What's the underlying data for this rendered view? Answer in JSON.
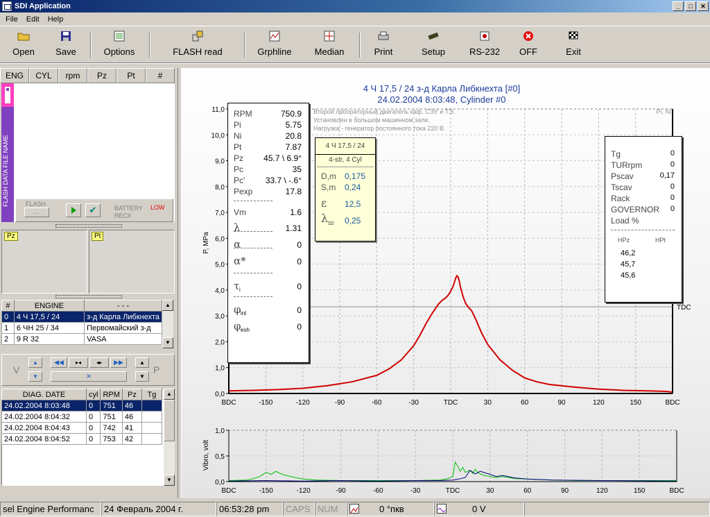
{
  "window": {
    "title": "SDI Application"
  },
  "menu": [
    "File",
    "Edit",
    "Help"
  ],
  "toolbar": [
    {
      "name": "open",
      "label": "Open",
      "icon": "folder-icon"
    },
    {
      "name": "save",
      "label": "Save",
      "icon": "floppy-icon"
    },
    {
      "name": "options",
      "label": "Options",
      "icon": "options-icon"
    },
    {
      "name": "flash-read",
      "label": "FLASH read",
      "icon": "flash-icon"
    },
    {
      "name": "grphline",
      "label": "Grphline",
      "icon": "graph-icon"
    },
    {
      "name": "median",
      "label": "Median",
      "icon": "median-icon"
    },
    {
      "name": "print",
      "label": "Print",
      "icon": "printer-icon"
    },
    {
      "name": "setup",
      "label": "Setup",
      "icon": "setup-icon"
    },
    {
      "name": "rs232",
      "label": "RS-232",
      "icon": "serial-icon"
    },
    {
      "name": "off",
      "label": "OFF",
      "icon": "stop-icon"
    },
    {
      "name": "exit",
      "label": "Exit",
      "icon": "flag-icon"
    }
  ],
  "top_table": {
    "headers": [
      "ENG",
      "CYL",
      "rpm",
      "Pz",
      "Pt",
      "#"
    ]
  },
  "flash": {
    "vertical_label": "FLASH DATA FILE NAME",
    "flash_label": "FLASH",
    "flash_btn": "...",
    "battery_label": "BATTERY",
    "battery_value": "LOW",
    "rec_label": "REC#"
  },
  "mini_panels": {
    "pz": "Pz",
    "pt": "Pt"
  },
  "engines": {
    "headers": [
      "#",
      "ENGINE",
      "- - -"
    ],
    "rows": [
      [
        "0",
        "4 Ч 17,5 / 24",
        "з-д Карла Либкнехта"
      ],
      [
        "1",
        "6 ЧН 25 / 34",
        "Первомайский з-д"
      ],
      [
        "2",
        "9 R 32",
        "VASA"
      ]
    ]
  },
  "nav": {
    "left": "V",
    "right": "P",
    "close": "×"
  },
  "diag": {
    "headers": [
      "DIAG. DATE",
      "cyl",
      "RPM",
      "Pz",
      "Tg"
    ],
    "rows": [
      [
        "24.02.2004 8:03:48",
        "0",
        "751",
        "46",
        ""
      ],
      [
        "24.02.2004 8:04:32",
        "0",
        "751",
        "46",
        ""
      ],
      [
        "24.02.2004 8:04:43",
        "0",
        "742",
        "41",
        ""
      ],
      [
        "24.02.2004 8:04:52",
        "0",
        "753",
        "42",
        ""
      ]
    ]
  },
  "chart_header": {
    "line1": "4 Ч 17,5 / 24 з-д Карла Либкнехта [#0]",
    "line2": "24.02.2004 8:03:48, Cylinder #0"
  },
  "notes": [
    "Второй лабораторный двигатель каф. СЭУ и ТЭ.",
    "Установлен в большом машинном зале.",
    "Нагрузка - генератор постоянного тока 220 В."
  ],
  "corner_label": "Pi, Ni",
  "params_left": [
    {
      "k": "RPM",
      "v": "750.9"
    },
    {
      "k": "Pi",
      "v": "5.75"
    },
    {
      "k": "Ni",
      "v": "20.8"
    },
    {
      "k": "Pt",
      "v": "7.87"
    },
    {
      "k": "Pz",
      "v": "45.7 \\ 6.9°"
    },
    {
      "k": "Pc",
      "v": "35"
    },
    {
      "k": "Pc'",
      "v": "33.7 \\ -.6°"
    },
    {
      "k": "Pexp",
      "v": "17.8"
    },
    {
      "k": "Vm",
      "v": "1.6"
    },
    {
      "k": "λ",
      "v": "1.31"
    },
    {
      "k": "α",
      "v": "0"
    },
    {
      "k": "α*",
      "v": "0"
    },
    {
      "k": "τ",
      "sub": "i",
      "v": "0"
    },
    {
      "k": "φ",
      "sub": "inl",
      "v": "0"
    },
    {
      "k": "φ",
      "sub": "exh",
      "v": "0"
    }
  ],
  "engine_card": {
    "title": "4 Ч 17,5 / 24",
    "subtitle": "4-str, 4 Cyl",
    "rows": [
      {
        "k": "D,m",
        "v": "0,175"
      },
      {
        "k": "S,m",
        "v": "0,24"
      },
      {
        "k": "ε",
        "v": "12,5"
      },
      {
        "k": "λ",
        "sub": "ш",
        "v": "0,25"
      }
    ]
  },
  "params_right": {
    "rows": [
      {
        "k": "Tg",
        "v": "0"
      },
      {
        "k": "TURrpm",
        "v": "0"
      },
      {
        "k": "Pscav",
        "v": "0,17"
      },
      {
        "k": "Tscav",
        "v": "0"
      },
      {
        "k": "Rack",
        "v": "0"
      },
      {
        "k": "GOVERNOR",
        "v": "0"
      },
      {
        "k": "Load %",
        "v": ""
      }
    ],
    "hpz_label": "HPz",
    "hpt_label": "HPt",
    "hpz_values": [
      "46,2",
      "45,7",
      "45,6"
    ]
  },
  "chart_data": [
    {
      "type": "line",
      "ylabel": "P, MPa",
      "ylim": [
        0,
        11
      ],
      "yticks": [
        "0,0",
        "1,0",
        "2,0",
        "3,0",
        "4,0",
        "5,0",
        "6,0",
        "7,0",
        "8,0",
        "9,0",
        "10,0",
        "11,0"
      ],
      "xticks": [
        "BDC",
        "-150",
        "-120",
        "-90",
        "-60",
        "-30",
        "TDC",
        "30",
        "60",
        "90",
        "120",
        "150",
        "BDC"
      ],
      "xlim": [
        -180,
        180
      ],
      "ref_line": {
        "y": 3.35,
        "label": "TDC"
      },
      "series": [
        {
          "color": "#d00000",
          "x": [
            -180,
            -160,
            -140,
            -120,
            -100,
            -80,
            -60,
            -50,
            -40,
            -30,
            -25,
            -20,
            -15,
            -10,
            -7,
            -4,
            -2,
            0,
            2,
            4,
            5,
            6,
            7,
            8,
            10,
            12,
            14,
            17,
            20,
            25,
            30,
            40,
            50,
            60,
            70,
            80,
            100,
            120,
            140,
            160,
            175,
            180
          ],
          "y": [
            0.1,
            0.12,
            0.15,
            0.2,
            0.3,
            0.45,
            0.7,
            0.95,
            1.3,
            1.85,
            2.25,
            2.7,
            3.1,
            3.45,
            3.6,
            3.7,
            3.8,
            3.95,
            4.15,
            4.45,
            4.55,
            4.5,
            4.35,
            4.1,
            3.75,
            3.5,
            3.35,
            3.2,
            2.9,
            2.35,
            1.9,
            1.3,
            0.9,
            0.6,
            0.45,
            0.35,
            0.25,
            0.17,
            0.12,
            0.1,
            0.08,
            0.05
          ]
        }
      ]
    },
    {
      "type": "line",
      "ylabel": "Vibro, volt",
      "ylim": [
        0,
        1
      ],
      "yticks": [
        "0,0",
        "0,5",
        "1,0"
      ],
      "xticks": [
        "BDC",
        "-150",
        "-120",
        "-90",
        "-60",
        "-30",
        "TDC",
        "30",
        "60",
        "90",
        "120",
        "150",
        "BDC"
      ],
      "xlim": [
        -180,
        180
      ],
      "series": [
        {
          "color": "#00c000",
          "x": [
            -180,
            -165,
            -160,
            -155,
            -150,
            -146,
            -142,
            -138,
            -134,
            -130,
            -125,
            -120,
            -110,
            -90,
            -60,
            -30,
            -10,
            -5,
            0,
            2,
            4,
            6,
            8,
            10,
            12,
            14,
            16,
            18,
            20,
            22,
            25,
            30,
            35,
            40,
            50,
            60,
            80,
            100,
            140,
            180
          ],
          "y": [
            0.02,
            0.03,
            0.06,
            0.1,
            0.18,
            0.14,
            0.2,
            0.15,
            0.12,
            0.1,
            0.07,
            0.05,
            0.03,
            0.02,
            0.02,
            0.02,
            0.03,
            0.05,
            0.1,
            0.38,
            0.3,
            0.2,
            0.28,
            0.18,
            0.2,
            0.22,
            0.16,
            0.24,
            0.18,
            0.15,
            0.12,
            0.1,
            0.08,
            0.1,
            0.06,
            0.05,
            0.03,
            0.02,
            0.02,
            0.02
          ]
        },
        {
          "color": "#000080",
          "x": [
            -180,
            -150,
            -120,
            -90,
            -60,
            -30,
            -10,
            0,
            5,
            10,
            14,
            18,
            22,
            26,
            30,
            35,
            40,
            50,
            60,
            80,
            120,
            180
          ],
          "y": [
            0.01,
            0.02,
            0.01,
            0.02,
            0.01,
            0.02,
            0.02,
            0.03,
            0.05,
            0.08,
            0.22,
            0.15,
            0.2,
            0.17,
            0.14,
            0.1,
            0.12,
            0.07,
            0.05,
            0.03,
            0.02,
            0.01
          ]
        }
      ]
    }
  ],
  "status": {
    "app": "sel Engine Performanc",
    "date": "24 Февраль 2004 г.",
    "time": "06:53:28 pm",
    "caps": "CAPS",
    "num": "NUM",
    "angle": "0 °пкв",
    "volt": "0 V"
  }
}
